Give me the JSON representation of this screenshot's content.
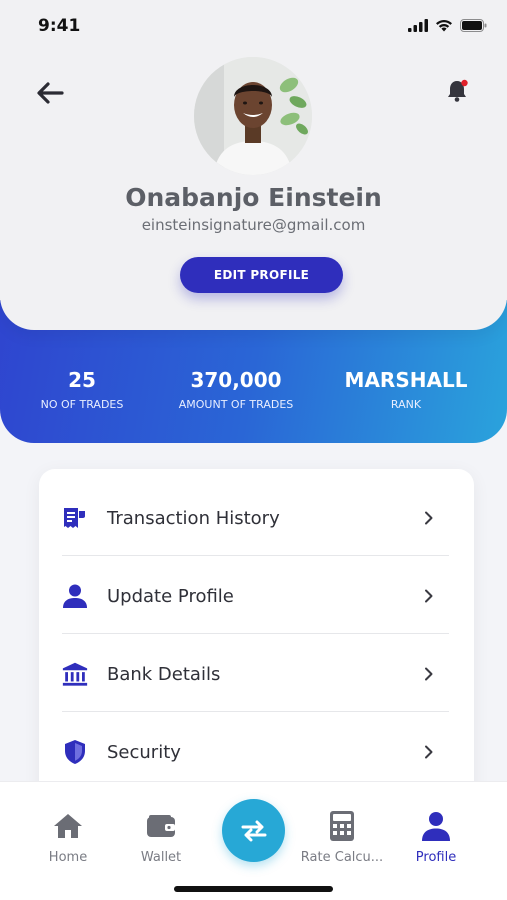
{
  "status_bar": {
    "time": "9:41"
  },
  "profile": {
    "name": "Onabanjo Einstein",
    "email": "einsteinsignature@gmail.com",
    "edit_label": "EDIT PROFILE"
  },
  "stats": [
    {
      "value": "25",
      "label": "NO OF TRADES"
    },
    {
      "value": "370,000",
      "label": "AMOUNT OF TRADES"
    },
    {
      "value": "MARSHALL",
      "label": "RANK"
    }
  ],
  "menu": [
    {
      "label": "Transaction History",
      "icon": "receipt-icon"
    },
    {
      "label": "Update Profile",
      "icon": "user-icon"
    },
    {
      "label": "Bank Details",
      "icon": "bank-icon"
    },
    {
      "label": "Security",
      "icon": "shield-icon"
    }
  ],
  "nav": [
    {
      "label": "Home",
      "icon": "home-icon"
    },
    {
      "label": "Wallet",
      "icon": "wallet-icon"
    },
    {
      "label": "Rate Calcu...",
      "icon": "calculator-icon"
    },
    {
      "label": "Profile",
      "icon": "profile-icon",
      "active": true
    }
  ],
  "colors": {
    "primary": "#2f2ebc",
    "accent": "#27a8d6",
    "gradient_start": "#2f45cf",
    "gradient_end": "#2aa3dc",
    "notification_dot": "#e0202a"
  }
}
